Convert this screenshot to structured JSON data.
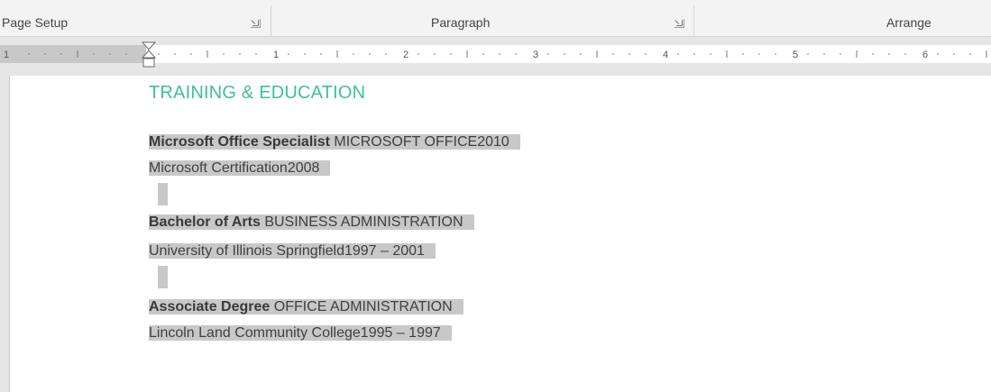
{
  "ribbon": {
    "groups": [
      {
        "label": "Page Setup"
      },
      {
        "label": "Paragraph"
      },
      {
        "label": "Arrange"
      }
    ]
  },
  "ruler": {
    "numbers": [
      "1",
      "1",
      "2",
      "3",
      "4",
      "5",
      "6"
    ]
  },
  "document": {
    "heading": "TRAINING & EDUCATION",
    "entries": [
      {
        "bold": "Microsoft Office Specialist",
        "field": " MICROSOFT OFFICE2010",
        "detail": "Microsoft Certification2008"
      },
      {
        "bold": "Bachelor of Arts",
        "field": " BUSINESS ADMINISTRATION",
        "detail": "University of Illinois Springfield1997 – 2001"
      },
      {
        "bold": "Associate Degree",
        "field": " OFFICE ADMINISTRATION",
        "detail": "Lincoln Land Community College1995 – 1997"
      }
    ]
  },
  "colors": {
    "heading": "#3fbf9a",
    "selection": "#c8c8c8",
    "ribbon_bg": "#f3f3f3",
    "body_text": "#404040"
  }
}
